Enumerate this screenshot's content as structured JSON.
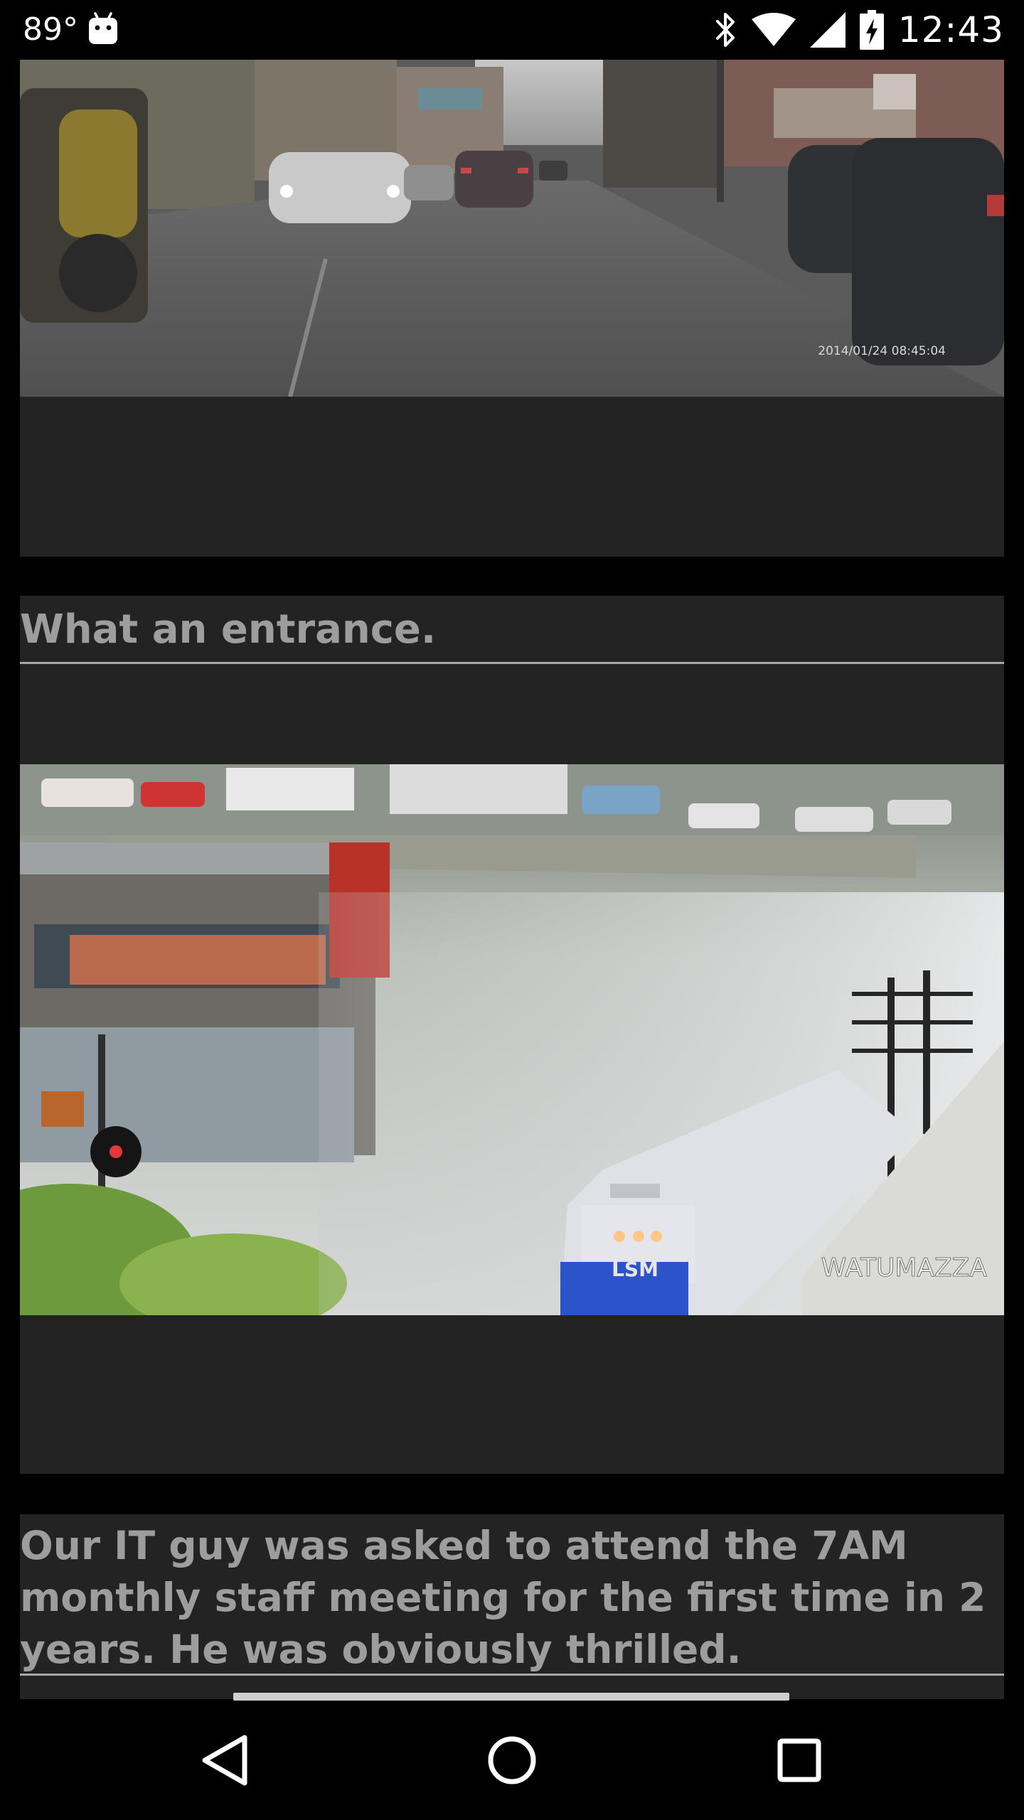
{
  "status_bar": {
    "temperature": "89°",
    "time": "12:43",
    "icons": [
      "android-icon",
      "bluetooth-icon",
      "wifi-icon",
      "cell-signal-icon",
      "battery-charging-icon"
    ]
  },
  "posts": [
    {
      "title": "",
      "media": "dashcam-street-clip",
      "timestamp_overlay": "2014/01/24 08:45:04"
    },
    {
      "title": "What an entrance.",
      "media": "train-through-flood-clip",
      "watermark": "WATUMAZZA",
      "train_label": "LSM"
    },
    {
      "title": "Our IT guy was asked to attend the 7AM monthly staff meeting for the first time in 2 years. He was obviously thrilled."
    }
  ],
  "nav_bar": {
    "buttons": [
      "back-button",
      "home-button",
      "recents-button"
    ]
  },
  "colors": {
    "background": "#000000",
    "card": "#232323",
    "title_text": "#9d9d9d",
    "divider": "#a8a8a8"
  }
}
